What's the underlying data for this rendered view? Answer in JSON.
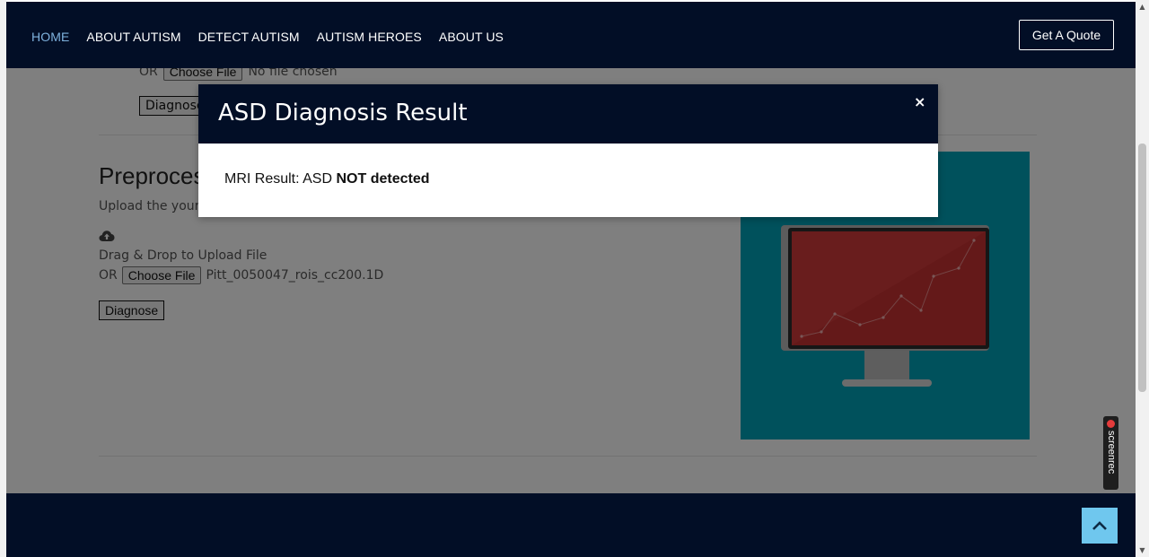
{
  "nav": {
    "items": [
      {
        "label": "HOME",
        "active": true
      },
      {
        "label": "ABOUT AUTISM",
        "active": false
      },
      {
        "label": "DETECT AUTISM",
        "active": false
      },
      {
        "label": "AUTISM HEROES",
        "active": false
      },
      {
        "label": "ABOUT US",
        "active": false
      }
    ],
    "quote_label": "Get A Quote"
  },
  "top_section": {
    "or_label": "OR",
    "choose_file_label": "Choose File",
    "file_status": "No file chosen",
    "diagnose_label": "Diagnose"
  },
  "preprocessed": {
    "title": "Preprocessed",
    "subtitle": "Upload the your",
    "drag_text": "Drag & Drop to Upload File",
    "or_label": "OR",
    "choose_file_label": "Choose File",
    "file_name": "Pitt_0050047_rois_cc200.1D",
    "diagnose_label": "Diagnose"
  },
  "modal": {
    "title": "ASD Diagnosis Result",
    "close_label": "×",
    "result_prefix": "MRI Result: ASD ",
    "result_status": "NOT detected"
  },
  "badge": {
    "label": "screenrec"
  },
  "colors": {
    "navy": "#020e26",
    "accent_link": "#7fb2de",
    "teal": "#00a2b8",
    "screen_red": "#d23a3a",
    "back_to_top": "#6fc7ee"
  }
}
